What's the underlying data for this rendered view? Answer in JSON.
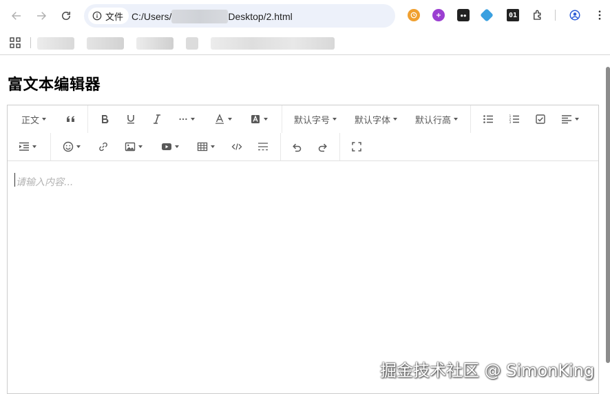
{
  "browser": {
    "chip_label": "文件",
    "url_prefix": "C:/Users/",
    "url_suffix": "Desktop/2.html"
  },
  "page": {
    "title": "富文本编辑器"
  },
  "toolbar": {
    "heading": "正文",
    "font_size": "默认字号",
    "font_family": "默认字体",
    "line_height": "默认行高"
  },
  "editor": {
    "placeholder": "请输入内容..."
  },
  "watermark": "掘金技术社区 @ SimonKing",
  "colors": {
    "omnibox_bg": "#edf1fa",
    "icon_gray": "#595959",
    "placeholder": "#b4b4b4"
  }
}
